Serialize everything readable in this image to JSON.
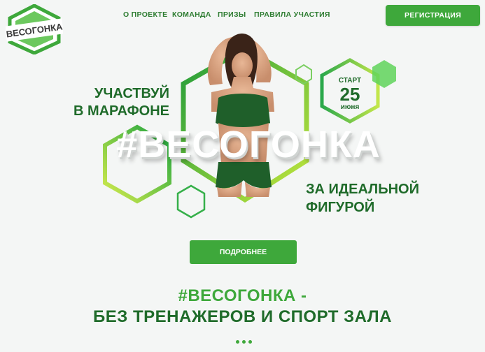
{
  "header": {
    "logo_text": "ВЕСОГОНКА",
    "nav": [
      {
        "label": "О ПРОЕКТЕ"
      },
      {
        "label": "КОМАНДА"
      },
      {
        "label": "ПРИЗЫ"
      },
      {
        "label": "ПРАВИЛА УЧАСТИЯ"
      }
    ],
    "register_label": "РЕГИСТРАЦИЯ"
  },
  "hero": {
    "tagline_left": [
      "УЧАСТВУЙ",
      "В МАРАФОНЕ"
    ],
    "tagline_right": [
      "ЗА ИДЕАЛЬНОЙ",
      "ФИГУРОЙ"
    ],
    "hashtag": "#ВЕСОГОНКА",
    "start": {
      "label": "СТАРТ",
      "day": "25",
      "month": "июня"
    },
    "more_label": "ПОДРОБНЕЕ"
  },
  "section": {
    "heading_1": "#ВЕСОГОНКА -",
    "heading_2": "БЕЗ ТРЕНАЖЕРОВ И СПОРТ ЗАЛА"
  },
  "colors": {
    "primary": "#3ea83b",
    "dark_green": "#1f6b2a",
    "light_green": "#b6e34a",
    "background": "#f4f6f5"
  }
}
